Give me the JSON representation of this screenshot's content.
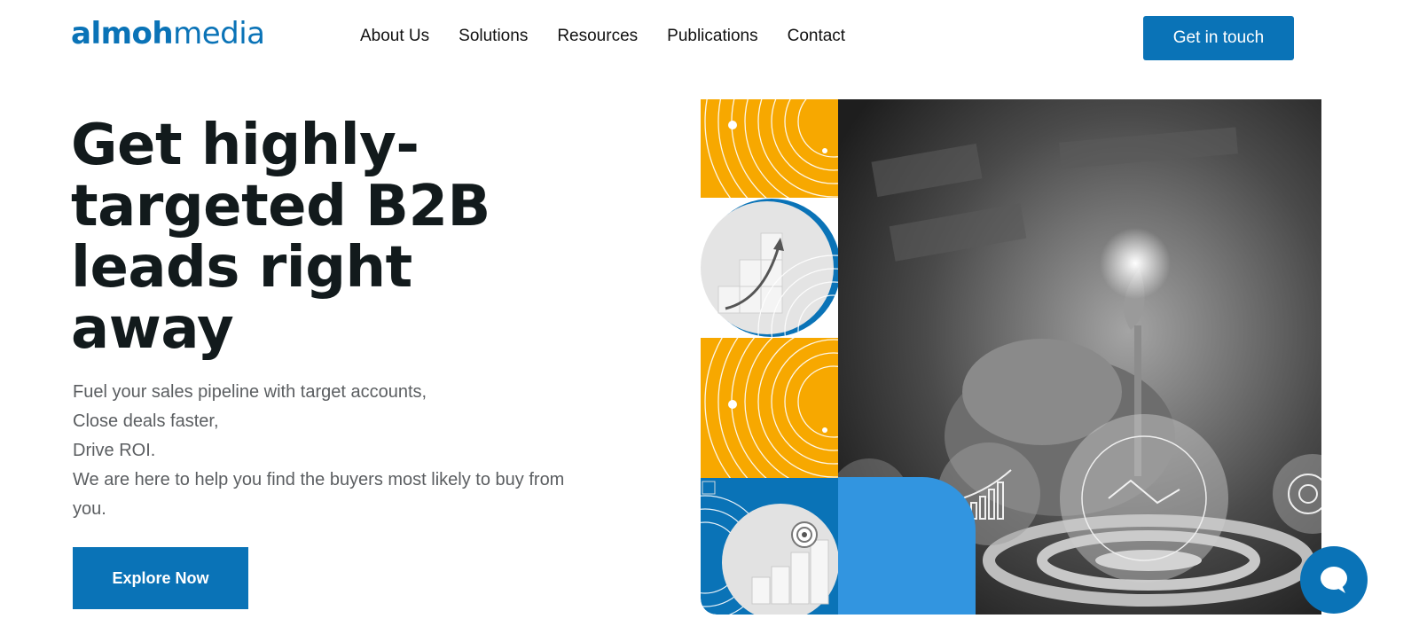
{
  "header": {
    "logo_bold": "almoh",
    "logo_light": "media",
    "nav": [
      "About Us",
      "Solutions",
      "Resources",
      "Publications",
      "Contact"
    ],
    "cta_label": "Get in touch"
  },
  "hero": {
    "headline": "Get highly-targeted B2B leads right away",
    "sub_lines": [
      "Fuel your sales pipeline with target accounts,",
      "Close deals faster,",
      "Drive ROI.",
      "We are here to help you find the buyers most likely to buy from you."
    ],
    "explore_label": "Explore Now"
  },
  "colors": {
    "brand_blue": "#0a73b7",
    "accent_yellow": "#f7a800",
    "accent_light_blue": "#3295e0"
  },
  "icons": {
    "chat": "chat-bubble-icon",
    "collage": [
      "concentric-arcs",
      "growth-chart-arrow",
      "concentric-arcs",
      "target-bar-chart",
      "dart-target-photo"
    ]
  }
}
